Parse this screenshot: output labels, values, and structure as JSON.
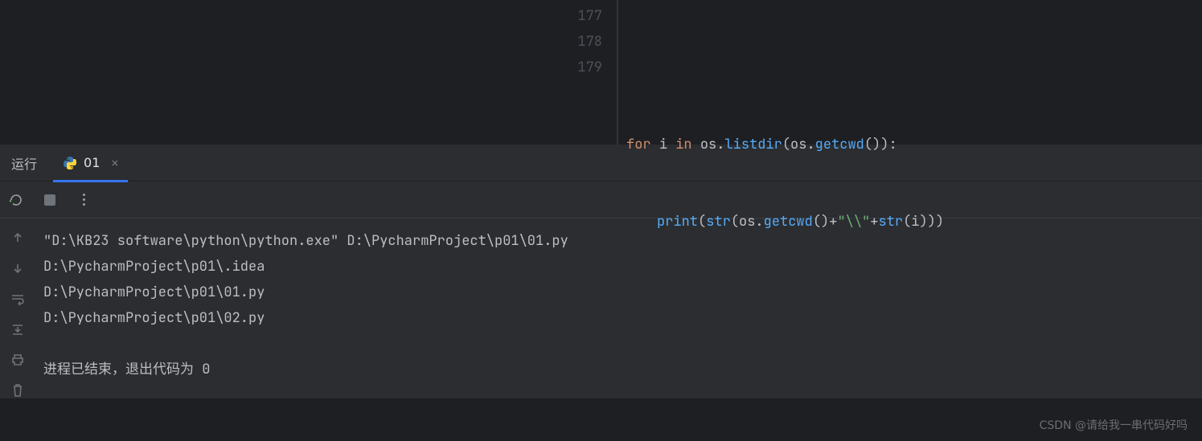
{
  "editor": {
    "gutter": [
      "177",
      "178",
      "179"
    ],
    "lines": {
      "l178": {
        "for": "for",
        "i": "i",
        "in": "in",
        "os": "os",
        "listdir": "listdir",
        "getcwd": "getcwd",
        "colon": ":"
      },
      "l179": {
        "print": "print",
        "str": "str",
        "os": "os",
        "getcwd": "getcwd",
        "plus1": "+",
        "esc": "\"\\\\\"",
        "plus2": "+",
        "i": "i"
      }
    }
  },
  "run": {
    "label": "运行",
    "tab_name": "01",
    "console_lines": [
      "\"D:\\KB23 software\\python\\python.exe\" D:\\PycharmProject\\p01\\01.py",
      "D:\\PycharmProject\\p01\\.idea",
      "D:\\PycharmProject\\p01\\01.py",
      "D:\\PycharmProject\\p01\\02.py"
    ],
    "exit_msg": "进程已结束，退出代码为 0"
  },
  "watermark": "CSDN @请给我一串代码好吗"
}
